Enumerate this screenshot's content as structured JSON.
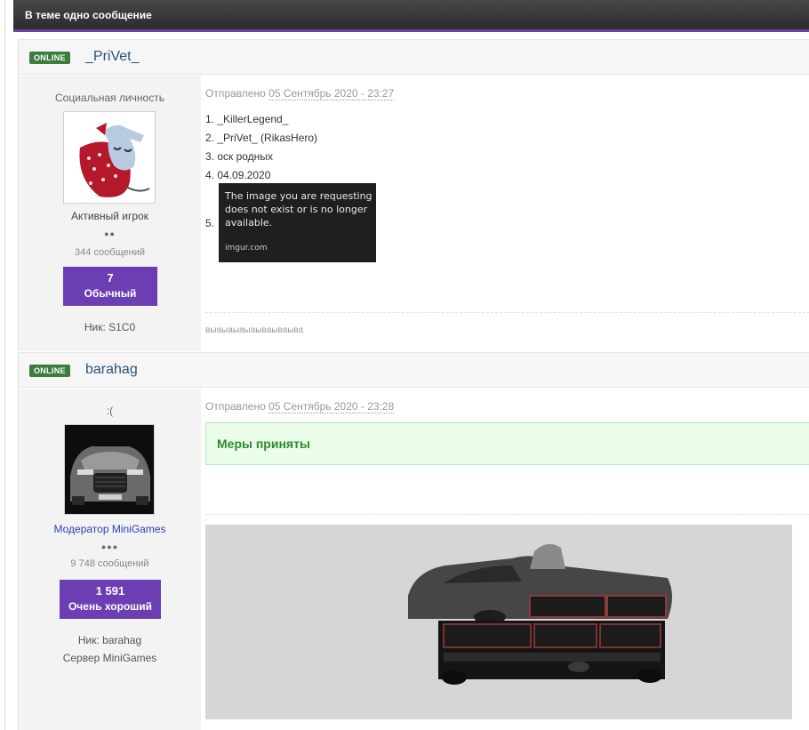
{
  "topic_bar": {
    "title": "В теме одно сообщение"
  },
  "posts": [
    {
      "online_badge": "ONLINE",
      "author": "_PriVet_",
      "user_title": "Социальная личность",
      "group": "Активный игрок",
      "pips": "●●",
      "post_count": "344 сообщений",
      "reputation": {
        "value": "7",
        "label": "Обычный"
      },
      "nick": "Ник: S1C0",
      "date_prefix": "Отправлено",
      "date": "05 Сентябрь 2020 - 23:27",
      "lines": [
        "1. _KillerLegend_",
        "2. _PriVet_ (RikasHero)",
        "3. оск родных",
        "4. 04.09.2020",
        "5."
      ],
      "broken_image": {
        "message": "The image you are requesting does not exist or is no longer available.",
        "host": "imgur.com"
      },
      "signature": "выаыаыаыаываываыва"
    },
    {
      "online_badge": "ONLINE",
      "author": "barahag",
      "user_title": ":(",
      "group": "Модератор MiniGames",
      "pips": "●●●",
      "post_count": "9 748 сообщений",
      "reputation": {
        "value": "1 591",
        "label": "Очень хороший"
      },
      "nick": "Ник: barahag",
      "server": "Сервер MiniGames",
      "date_prefix": "Отправлено",
      "date": "05 Сентябрь 2020 - 23:28",
      "notice": "Меры приняты"
    }
  ],
  "colors": {
    "accent_purple": "#6b3fb3",
    "online_green": "#3c7c3c",
    "notice_bg": "#e9fde9",
    "notice_text": "#2f8a2f"
  }
}
